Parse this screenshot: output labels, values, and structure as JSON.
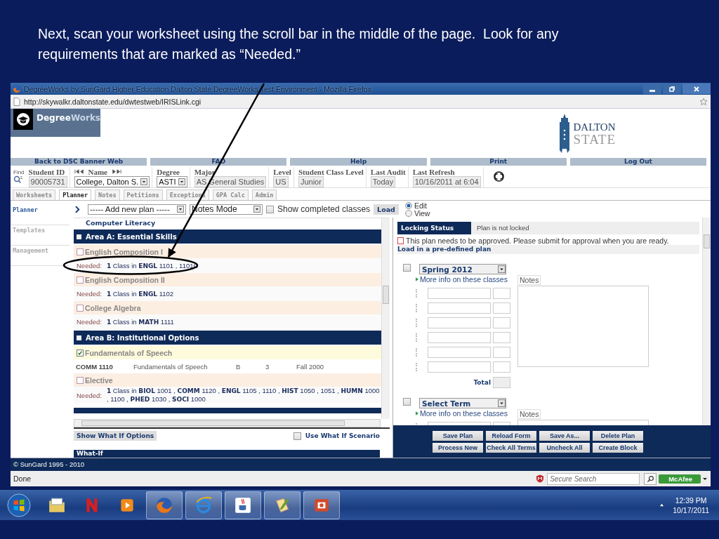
{
  "caption": "Next, scan your worksheet using the scroll bar in the middle of the page.  Look for any requirements that are marked as “Needed.”",
  "window": {
    "title": "DegreeWorks by SunGard Higher Education Dalton State DegreeWorks Test Environment - Mozilla Firefox",
    "url": "http://skywalkr.daltonstate.edu/dwtestweb/IRISLink.cgi"
  },
  "logo": [
    "Degree",
    "Works"
  ],
  "school_logo": [
    "DALTON",
    "STATE"
  ],
  "nav": [
    "Back to DSC Banner Web",
    "FAO",
    "Help",
    "Print",
    "Log Out"
  ],
  "student": {
    "find": "Find",
    "fields": [
      {
        "label": "Student ID",
        "value": "90005731",
        "kind": "text"
      },
      {
        "label": "Name",
        "value": "College, Dalton S.",
        "kind": "nav_select"
      },
      {
        "label": "Degree",
        "value": "ASTI",
        "kind": "select"
      },
      {
        "label": "Major",
        "value": "AS General Studies",
        "kind": "text"
      },
      {
        "label": "Level",
        "value": "US",
        "kind": "text"
      },
      {
        "label": "Student Class Level",
        "value": "Junior",
        "kind": "text"
      },
      {
        "label": "Last Audit",
        "value": "Today",
        "kind": "text"
      },
      {
        "label": "Last Refresh",
        "value": "10/16/2011 at 6:04",
        "kind": "text"
      }
    ]
  },
  "tabs": [
    {
      "label": "Worksheets",
      "selected": false
    },
    {
      "label": "Planner",
      "selected": true
    },
    {
      "label": "Notes",
      "selected": false
    },
    {
      "label": "Petitions",
      "selected": false
    },
    {
      "label": "Exceptions",
      "selected": false
    },
    {
      "label": "GPA Calc",
      "selected": false
    },
    {
      "label": "Admin",
      "selected": false
    }
  ],
  "sidebar": [
    {
      "label": "Planner",
      "selected": true
    },
    {
      "label": "Templates",
      "selected": false
    },
    {
      "label": "Management",
      "selected": false
    }
  ],
  "toolbar": {
    "plan_select": "----- Add new plan -----",
    "mode_select": "Notes Mode",
    "show_completed": {
      "label": "Show completed classes",
      "checked": false
    },
    "load": "Load",
    "modes": [
      {
        "label": "Edit",
        "selected": true
      },
      {
        "label": "View",
        "selected": false
      }
    ]
  },
  "worksheet": [
    {
      "kind": "subhead",
      "title": "Computer Literacy"
    },
    {
      "kind": "area",
      "title": "Area A: Essential Skills"
    },
    {
      "kind": "requirement",
      "title": "English Composition I",
      "checked": false
    },
    {
      "kind": "needed",
      "label": "Needed:",
      "text": "**1** Class in **ENGL** 1101 , 1101C"
    },
    {
      "kind": "requirement",
      "title": "English Composition II",
      "checked": false
    },
    {
      "kind": "needed",
      "label": "Needed:",
      "text": "**1** Class in **ENGL** 1102"
    },
    {
      "kind": "requirement",
      "title": "College Algebra",
      "checked": false
    },
    {
      "kind": "needed",
      "label": "Needed:",
      "text": "**1** Class in **MATH** 1111"
    },
    {
      "kind": "area",
      "title": "Area B: Institutional Options"
    },
    {
      "kind": "requirement",
      "title": "Fundamentals of Speech",
      "checked": true
    },
    {
      "kind": "course",
      "cells": [
        "COMM 1110",
        "Fundamentals of Speech",
        "B",
        "3",
        "Fall 2000"
      ]
    },
    {
      "kind": "requirement",
      "title": "Elective",
      "checked": false
    },
    {
      "kind": "needed",
      "label": "Needed:",
      "text": "**1** Class in **BIOL** 1001 , **COMM** 1120 , **ENGL** 1105 , 1110 , **HIST** 1050 , 1051 , **HUMN** 1000 , 1100 , **PHED** 1030 , **SOCI** 1000"
    }
  ],
  "whatif": {
    "button": "Show What If Options",
    "checkbox": {
      "label": "Use What If Scenario",
      "checked": false
    },
    "header": "What-If"
  },
  "plan": {
    "info": [
      {
        "label": "Locking Status",
        "value": "Plan is not locked"
      }
    ],
    "notice": "This plan needs to be approved. Please submit for approval when you are ready.",
    "load_label": "Load in a pre-defined plan",
    "terms": [
      {
        "term": "Spring 2012",
        "checked": false,
        "more": "More info on these classes",
        "notes": "Notes",
        "total": "Total"
      },
      {
        "term": "Select Term",
        "checked": false,
        "more": "More info on these classes",
        "notes": "Notes"
      }
    ],
    "buttons": [
      "Save Plan",
      "Reload Form",
      "Save As...",
      "Delete Plan",
      "Process New",
      "Check All Terms",
      "Uncheck All",
      "Create Block"
    ]
  },
  "footer": "© SunGard 1995 - 2010",
  "status": {
    "text": "Done",
    "search_placeholder": "Secure Search",
    "addon": "McAfee"
  },
  "clock": {
    "time": "12:39 PM",
    "date": "10/17/2011"
  }
}
